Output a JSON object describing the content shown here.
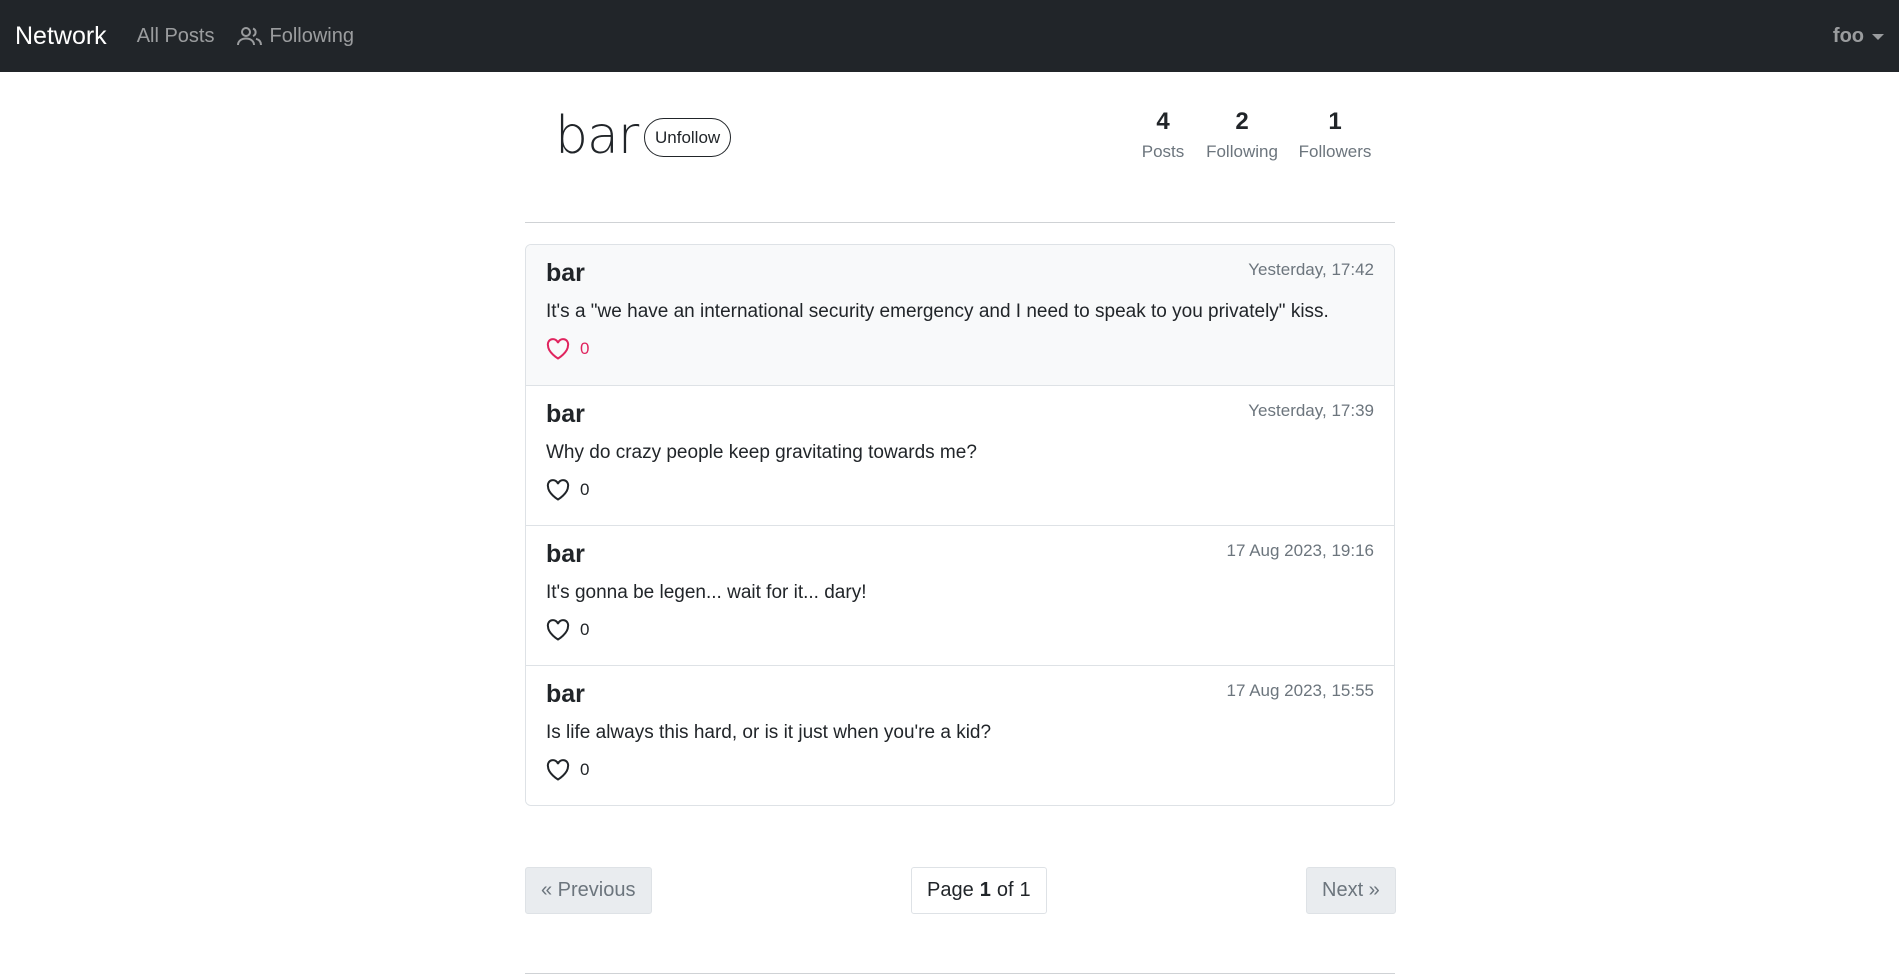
{
  "navbar": {
    "brand": "Network",
    "all_posts": "All Posts",
    "following": "Following",
    "user": "foo"
  },
  "profile": {
    "username": "bar",
    "follow_button": "Unfollow",
    "stats": [
      {
        "value": "4",
        "label": "Posts"
      },
      {
        "value": "2",
        "label": "Following"
      },
      {
        "value": "1",
        "label": "Followers"
      }
    ]
  },
  "posts": [
    {
      "author": "bar",
      "time": "Yesterday, 17:42",
      "body": "It's a \"we have an international security emergency and I need to speak to you privately\" kiss.",
      "likes": "0",
      "liked": true
    },
    {
      "author": "bar",
      "time": "Yesterday, 17:39",
      "body": "Why do crazy people keep gravitating towards me?",
      "likes": "0",
      "liked": false
    },
    {
      "author": "bar",
      "time": "17 Aug 2023, 19:16",
      "body": "It's gonna be legen... wait for it... dary!",
      "likes": "0",
      "liked": false
    },
    {
      "author": "bar",
      "time": "17 Aug 2023, 15:55",
      "body": "Is life always this hard, or is it just when you're a kid?",
      "likes": "0",
      "liked": false
    }
  ],
  "pagination": {
    "previous": "« Previous",
    "next": "Next »",
    "page_word": "Page",
    "current": "1",
    "of_word": "of",
    "total": "1"
  },
  "colors": {
    "navbar_bg": "#212529",
    "like_active": "#e0245e"
  }
}
